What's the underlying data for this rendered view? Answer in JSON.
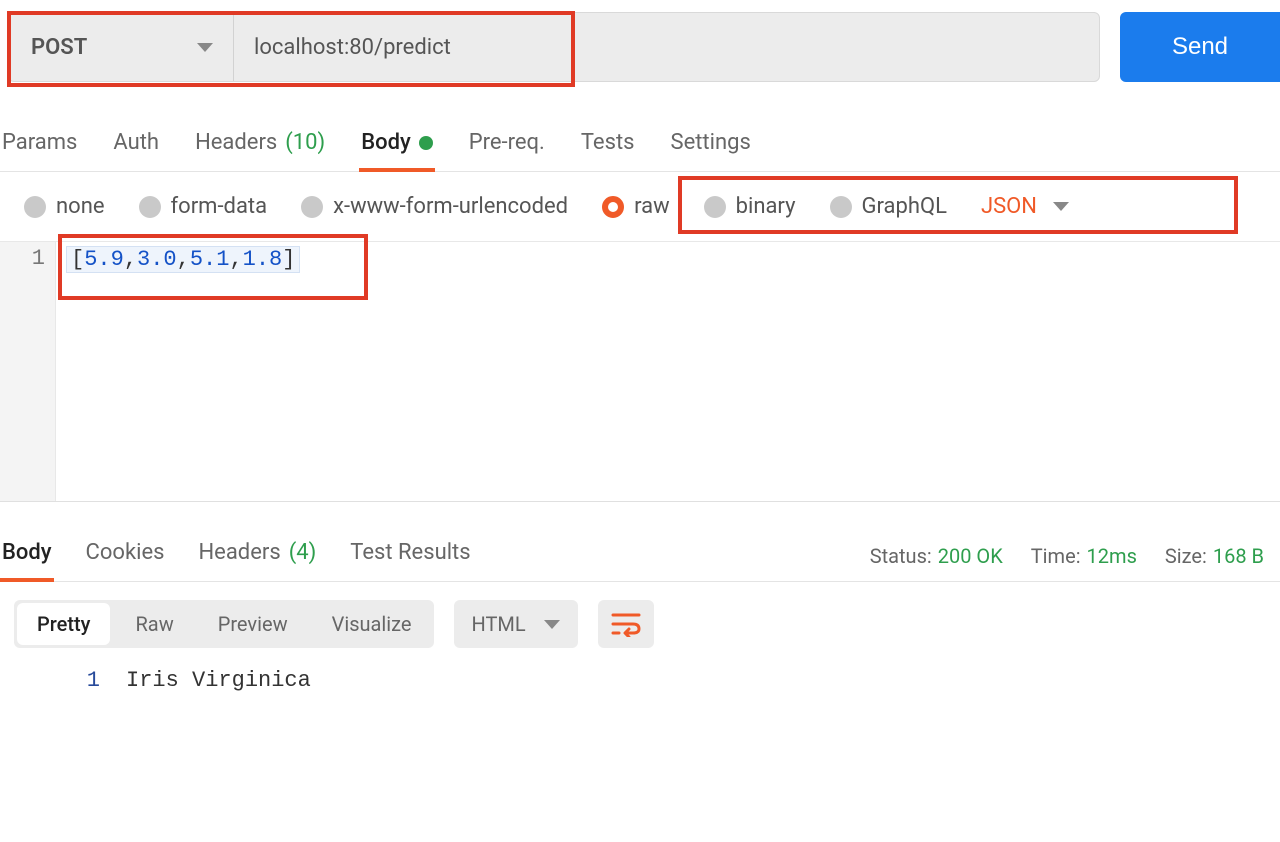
{
  "request": {
    "method": "POST",
    "url": "localhost:80/predict",
    "send_label": "Send"
  },
  "req_tabs": {
    "params": "Params",
    "auth": "Auth",
    "headers_label": "Headers",
    "headers_count": "(10)",
    "body": "Body",
    "prereq": "Pre-req.",
    "tests": "Tests",
    "settings": "Settings"
  },
  "body_types": {
    "none": "none",
    "form_data": "form-data",
    "xform": "x-www-form-urlencoded",
    "raw": "raw",
    "binary": "binary",
    "graphql": "GraphQL",
    "json_dd": "JSON"
  },
  "editor": {
    "line_no": "1",
    "body_values": [
      "5.9",
      "3.0",
      "5.1",
      "1.8"
    ]
  },
  "resp_tabs": {
    "body": "Body",
    "cookies": "Cookies",
    "headers_label": "Headers",
    "headers_count": "(4)",
    "test_results": "Test Results"
  },
  "meta": {
    "status_label": "Status:",
    "status_value": "200 OK",
    "time_label": "Time:",
    "time_value": "12ms",
    "size_label": "Size:",
    "size_value": "168 B"
  },
  "resp_toolbar": {
    "pretty": "Pretty",
    "raw": "Raw",
    "preview": "Preview",
    "visualize": "Visualize",
    "lang": "HTML"
  },
  "resp_body": {
    "line_no": "1",
    "text": "Iris Virginica"
  }
}
